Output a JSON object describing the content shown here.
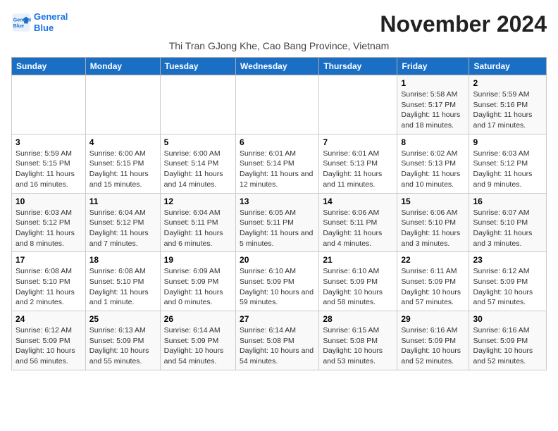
{
  "logo": {
    "line1": "General",
    "line2": "Blue"
  },
  "title": "November 2024",
  "subtitle": "Thi Tran GJong Khe, Cao Bang Province, Vietnam",
  "days_of_week": [
    "Sunday",
    "Monday",
    "Tuesday",
    "Wednesday",
    "Thursday",
    "Friday",
    "Saturday"
  ],
  "weeks": [
    [
      {
        "day": "",
        "info": ""
      },
      {
        "day": "",
        "info": ""
      },
      {
        "day": "",
        "info": ""
      },
      {
        "day": "",
        "info": ""
      },
      {
        "day": "",
        "info": ""
      },
      {
        "day": "1",
        "info": "Sunrise: 5:58 AM\nSunset: 5:17 PM\nDaylight: 11 hours and 18 minutes."
      },
      {
        "day": "2",
        "info": "Sunrise: 5:59 AM\nSunset: 5:16 PM\nDaylight: 11 hours and 17 minutes."
      }
    ],
    [
      {
        "day": "3",
        "info": "Sunrise: 5:59 AM\nSunset: 5:15 PM\nDaylight: 11 hours and 16 minutes."
      },
      {
        "day": "4",
        "info": "Sunrise: 6:00 AM\nSunset: 5:15 PM\nDaylight: 11 hours and 15 minutes."
      },
      {
        "day": "5",
        "info": "Sunrise: 6:00 AM\nSunset: 5:14 PM\nDaylight: 11 hours and 14 minutes."
      },
      {
        "day": "6",
        "info": "Sunrise: 6:01 AM\nSunset: 5:14 PM\nDaylight: 11 hours and 12 minutes."
      },
      {
        "day": "7",
        "info": "Sunrise: 6:01 AM\nSunset: 5:13 PM\nDaylight: 11 hours and 11 minutes."
      },
      {
        "day": "8",
        "info": "Sunrise: 6:02 AM\nSunset: 5:13 PM\nDaylight: 11 hours and 10 minutes."
      },
      {
        "day": "9",
        "info": "Sunrise: 6:03 AM\nSunset: 5:12 PM\nDaylight: 11 hours and 9 minutes."
      }
    ],
    [
      {
        "day": "10",
        "info": "Sunrise: 6:03 AM\nSunset: 5:12 PM\nDaylight: 11 hours and 8 minutes."
      },
      {
        "day": "11",
        "info": "Sunrise: 6:04 AM\nSunset: 5:12 PM\nDaylight: 11 hours and 7 minutes."
      },
      {
        "day": "12",
        "info": "Sunrise: 6:04 AM\nSunset: 5:11 PM\nDaylight: 11 hours and 6 minutes."
      },
      {
        "day": "13",
        "info": "Sunrise: 6:05 AM\nSunset: 5:11 PM\nDaylight: 11 hours and 5 minutes."
      },
      {
        "day": "14",
        "info": "Sunrise: 6:06 AM\nSunset: 5:11 PM\nDaylight: 11 hours and 4 minutes."
      },
      {
        "day": "15",
        "info": "Sunrise: 6:06 AM\nSunset: 5:10 PM\nDaylight: 11 hours and 3 minutes."
      },
      {
        "day": "16",
        "info": "Sunrise: 6:07 AM\nSunset: 5:10 PM\nDaylight: 11 hours and 3 minutes."
      }
    ],
    [
      {
        "day": "17",
        "info": "Sunrise: 6:08 AM\nSunset: 5:10 PM\nDaylight: 11 hours and 2 minutes."
      },
      {
        "day": "18",
        "info": "Sunrise: 6:08 AM\nSunset: 5:10 PM\nDaylight: 11 hours and 1 minute."
      },
      {
        "day": "19",
        "info": "Sunrise: 6:09 AM\nSunset: 5:09 PM\nDaylight: 11 hours and 0 minutes."
      },
      {
        "day": "20",
        "info": "Sunrise: 6:10 AM\nSunset: 5:09 PM\nDaylight: 10 hours and 59 minutes."
      },
      {
        "day": "21",
        "info": "Sunrise: 6:10 AM\nSunset: 5:09 PM\nDaylight: 10 hours and 58 minutes."
      },
      {
        "day": "22",
        "info": "Sunrise: 6:11 AM\nSunset: 5:09 PM\nDaylight: 10 hours and 57 minutes."
      },
      {
        "day": "23",
        "info": "Sunrise: 6:12 AM\nSunset: 5:09 PM\nDaylight: 10 hours and 57 minutes."
      }
    ],
    [
      {
        "day": "24",
        "info": "Sunrise: 6:12 AM\nSunset: 5:09 PM\nDaylight: 10 hours and 56 minutes."
      },
      {
        "day": "25",
        "info": "Sunrise: 6:13 AM\nSunset: 5:09 PM\nDaylight: 10 hours and 55 minutes."
      },
      {
        "day": "26",
        "info": "Sunrise: 6:14 AM\nSunset: 5:09 PM\nDaylight: 10 hours and 54 minutes."
      },
      {
        "day": "27",
        "info": "Sunrise: 6:14 AM\nSunset: 5:08 PM\nDaylight: 10 hours and 54 minutes."
      },
      {
        "day": "28",
        "info": "Sunrise: 6:15 AM\nSunset: 5:08 PM\nDaylight: 10 hours and 53 minutes."
      },
      {
        "day": "29",
        "info": "Sunrise: 6:16 AM\nSunset: 5:09 PM\nDaylight: 10 hours and 52 minutes."
      },
      {
        "day": "30",
        "info": "Sunrise: 6:16 AM\nSunset: 5:09 PM\nDaylight: 10 hours and 52 minutes."
      }
    ]
  ]
}
